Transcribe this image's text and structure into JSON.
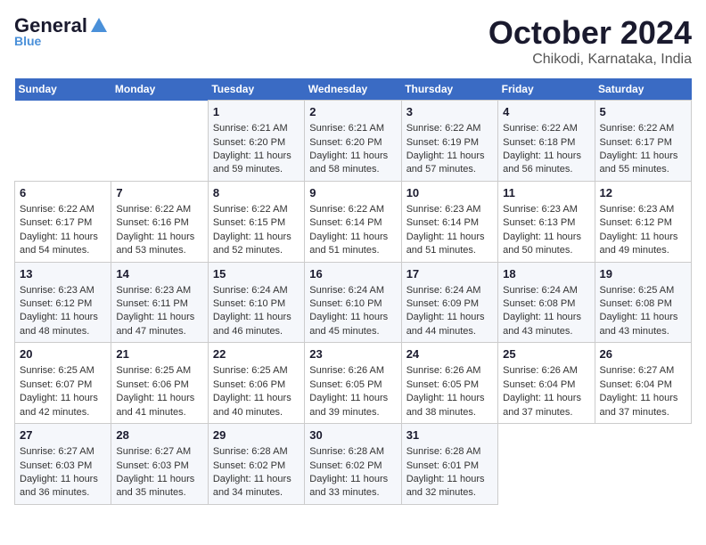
{
  "header": {
    "logo_general": "General",
    "logo_blue": "Blue",
    "month_title": "October 2024",
    "location": "Chikodi, Karnataka, India"
  },
  "days_of_week": [
    "Sunday",
    "Monday",
    "Tuesday",
    "Wednesday",
    "Thursday",
    "Friday",
    "Saturday"
  ],
  "weeks": [
    [
      {
        "day": "",
        "sunrise": "",
        "sunset": "",
        "daylight": ""
      },
      {
        "day": "",
        "sunrise": "",
        "sunset": "",
        "daylight": ""
      },
      {
        "day": "1",
        "sunrise": "Sunrise: 6:21 AM",
        "sunset": "Sunset: 6:20 PM",
        "daylight": "Daylight: 11 hours and 59 minutes."
      },
      {
        "day": "2",
        "sunrise": "Sunrise: 6:21 AM",
        "sunset": "Sunset: 6:20 PM",
        "daylight": "Daylight: 11 hours and 58 minutes."
      },
      {
        "day": "3",
        "sunrise": "Sunrise: 6:22 AM",
        "sunset": "Sunset: 6:19 PM",
        "daylight": "Daylight: 11 hours and 57 minutes."
      },
      {
        "day": "4",
        "sunrise": "Sunrise: 6:22 AM",
        "sunset": "Sunset: 6:18 PM",
        "daylight": "Daylight: 11 hours and 56 minutes."
      },
      {
        "day": "5",
        "sunrise": "Sunrise: 6:22 AM",
        "sunset": "Sunset: 6:17 PM",
        "daylight": "Daylight: 11 hours and 55 minutes."
      }
    ],
    [
      {
        "day": "6",
        "sunrise": "Sunrise: 6:22 AM",
        "sunset": "Sunset: 6:17 PM",
        "daylight": "Daylight: 11 hours and 54 minutes."
      },
      {
        "day": "7",
        "sunrise": "Sunrise: 6:22 AM",
        "sunset": "Sunset: 6:16 PM",
        "daylight": "Daylight: 11 hours and 53 minutes."
      },
      {
        "day": "8",
        "sunrise": "Sunrise: 6:22 AM",
        "sunset": "Sunset: 6:15 PM",
        "daylight": "Daylight: 11 hours and 52 minutes."
      },
      {
        "day": "9",
        "sunrise": "Sunrise: 6:22 AM",
        "sunset": "Sunset: 6:14 PM",
        "daylight": "Daylight: 11 hours and 51 minutes."
      },
      {
        "day": "10",
        "sunrise": "Sunrise: 6:23 AM",
        "sunset": "Sunset: 6:14 PM",
        "daylight": "Daylight: 11 hours and 51 minutes."
      },
      {
        "day": "11",
        "sunrise": "Sunrise: 6:23 AM",
        "sunset": "Sunset: 6:13 PM",
        "daylight": "Daylight: 11 hours and 50 minutes."
      },
      {
        "day": "12",
        "sunrise": "Sunrise: 6:23 AM",
        "sunset": "Sunset: 6:12 PM",
        "daylight": "Daylight: 11 hours and 49 minutes."
      }
    ],
    [
      {
        "day": "13",
        "sunrise": "Sunrise: 6:23 AM",
        "sunset": "Sunset: 6:12 PM",
        "daylight": "Daylight: 11 hours and 48 minutes."
      },
      {
        "day": "14",
        "sunrise": "Sunrise: 6:23 AM",
        "sunset": "Sunset: 6:11 PM",
        "daylight": "Daylight: 11 hours and 47 minutes."
      },
      {
        "day": "15",
        "sunrise": "Sunrise: 6:24 AM",
        "sunset": "Sunset: 6:10 PM",
        "daylight": "Daylight: 11 hours and 46 minutes."
      },
      {
        "day": "16",
        "sunrise": "Sunrise: 6:24 AM",
        "sunset": "Sunset: 6:10 PM",
        "daylight": "Daylight: 11 hours and 45 minutes."
      },
      {
        "day": "17",
        "sunrise": "Sunrise: 6:24 AM",
        "sunset": "Sunset: 6:09 PM",
        "daylight": "Daylight: 11 hours and 44 minutes."
      },
      {
        "day": "18",
        "sunrise": "Sunrise: 6:24 AM",
        "sunset": "Sunset: 6:08 PM",
        "daylight": "Daylight: 11 hours and 43 minutes."
      },
      {
        "day": "19",
        "sunrise": "Sunrise: 6:25 AM",
        "sunset": "Sunset: 6:08 PM",
        "daylight": "Daylight: 11 hours and 43 minutes."
      }
    ],
    [
      {
        "day": "20",
        "sunrise": "Sunrise: 6:25 AM",
        "sunset": "Sunset: 6:07 PM",
        "daylight": "Daylight: 11 hours and 42 minutes."
      },
      {
        "day": "21",
        "sunrise": "Sunrise: 6:25 AM",
        "sunset": "Sunset: 6:06 PM",
        "daylight": "Daylight: 11 hours and 41 minutes."
      },
      {
        "day": "22",
        "sunrise": "Sunrise: 6:25 AM",
        "sunset": "Sunset: 6:06 PM",
        "daylight": "Daylight: 11 hours and 40 minutes."
      },
      {
        "day": "23",
        "sunrise": "Sunrise: 6:26 AM",
        "sunset": "Sunset: 6:05 PM",
        "daylight": "Daylight: 11 hours and 39 minutes."
      },
      {
        "day": "24",
        "sunrise": "Sunrise: 6:26 AM",
        "sunset": "Sunset: 6:05 PM",
        "daylight": "Daylight: 11 hours and 38 minutes."
      },
      {
        "day": "25",
        "sunrise": "Sunrise: 6:26 AM",
        "sunset": "Sunset: 6:04 PM",
        "daylight": "Daylight: 11 hours and 37 minutes."
      },
      {
        "day": "26",
        "sunrise": "Sunrise: 6:27 AM",
        "sunset": "Sunset: 6:04 PM",
        "daylight": "Daylight: 11 hours and 37 minutes."
      }
    ],
    [
      {
        "day": "27",
        "sunrise": "Sunrise: 6:27 AM",
        "sunset": "Sunset: 6:03 PM",
        "daylight": "Daylight: 11 hours and 36 minutes."
      },
      {
        "day": "28",
        "sunrise": "Sunrise: 6:27 AM",
        "sunset": "Sunset: 6:03 PM",
        "daylight": "Daylight: 11 hours and 35 minutes."
      },
      {
        "day": "29",
        "sunrise": "Sunrise: 6:28 AM",
        "sunset": "Sunset: 6:02 PM",
        "daylight": "Daylight: 11 hours and 34 minutes."
      },
      {
        "day": "30",
        "sunrise": "Sunrise: 6:28 AM",
        "sunset": "Sunset: 6:02 PM",
        "daylight": "Daylight: 11 hours and 33 minutes."
      },
      {
        "day": "31",
        "sunrise": "Sunrise: 6:28 AM",
        "sunset": "Sunset: 6:01 PM",
        "daylight": "Daylight: 11 hours and 32 minutes."
      },
      {
        "day": "",
        "sunrise": "",
        "sunset": "",
        "daylight": ""
      },
      {
        "day": "",
        "sunrise": "",
        "sunset": "",
        "daylight": ""
      }
    ]
  ]
}
